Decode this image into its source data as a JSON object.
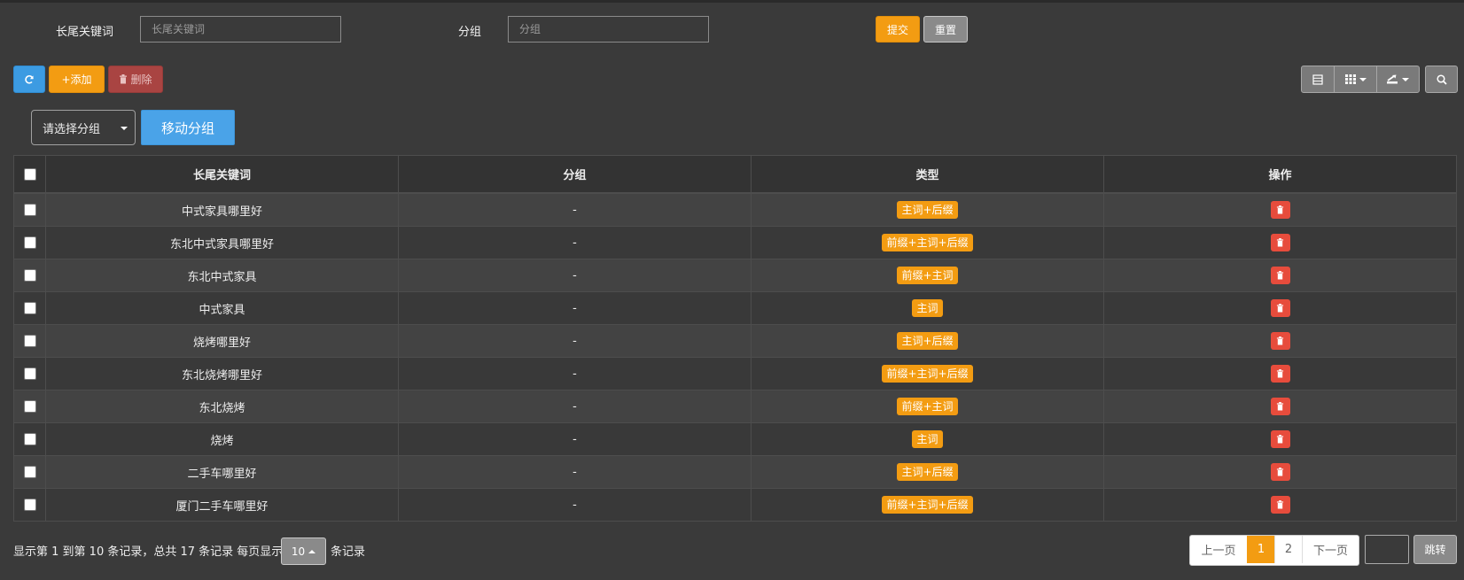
{
  "search": {
    "keyword_label": "长尾关键词",
    "keyword_placeholder": "长尾关键词",
    "group_label": "分组",
    "group_placeholder": "分组",
    "submit_label": "提交",
    "reset_label": "重置"
  },
  "toolbar": {
    "refresh_icon": "refresh-icon",
    "add_label": "+添加",
    "delete_label": "删除",
    "tools": [
      "table-view-icon",
      "columns-icon",
      "export-icon",
      "search-icon"
    ]
  },
  "group_move": {
    "select_value": "请选择分组",
    "move_label": "移动分组"
  },
  "table": {
    "headers": [
      "长尾关键词",
      "分组",
      "类型",
      "操作"
    ],
    "rows": [
      {
        "keyword": "中式家具哪里好",
        "group": "-",
        "type": "主词+后缀"
      },
      {
        "keyword": "东北中式家具哪里好",
        "group": "-",
        "type": "前缀+主词+后缀"
      },
      {
        "keyword": "东北中式家具",
        "group": "-",
        "type": "前缀+主词"
      },
      {
        "keyword": "中式家具",
        "group": "-",
        "type": "主词"
      },
      {
        "keyword": "烧烤哪里好",
        "group": "-",
        "type": "主词+后缀"
      },
      {
        "keyword": "东北烧烤哪里好",
        "group": "-",
        "type": "前缀+主词+后缀"
      },
      {
        "keyword": "东北烧烤",
        "group": "-",
        "type": "前缀+主词"
      },
      {
        "keyword": "烧烤",
        "group": "-",
        "type": "主词"
      },
      {
        "keyword": "二手车哪里好",
        "group": "-",
        "type": "主词+后缀"
      },
      {
        "keyword": "厦门二手车哪里好",
        "group": "-",
        "type": "前缀+主词+后缀"
      }
    ]
  },
  "footer": {
    "summary": "显示第 1 到第 10 条记录，总共 17 条记录 每页显示",
    "page_size": "10",
    "records_suffix": "条记录",
    "pager": {
      "prev": "上一页",
      "pages": [
        "1",
        "2"
      ],
      "active_page": "1",
      "next": "下一页"
    },
    "jump_label": "跳转"
  },
  "colors": {
    "background": "#3a3a3a",
    "accent_orange": "#f39c12",
    "accent_blue": "#3c9be2",
    "danger_red": "#e74c3c"
  }
}
